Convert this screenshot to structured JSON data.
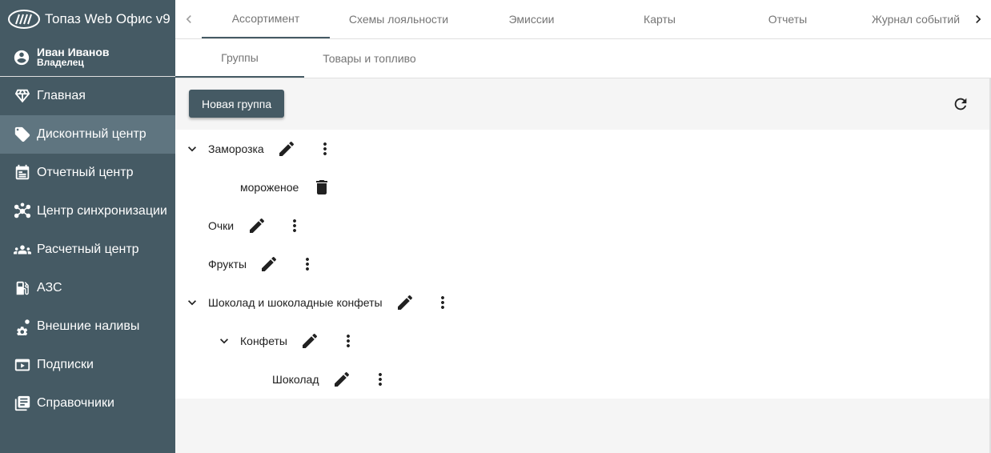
{
  "app": {
    "title": "Топаз Web Офис v9"
  },
  "user": {
    "name": "Иван Иванов",
    "role": "Владелец"
  },
  "sidebar": {
    "items": [
      {
        "label": "Главная",
        "icon": "diamond-icon",
        "active": false
      },
      {
        "label": "Дисконтный центр",
        "icon": "tag-icon",
        "active": true
      },
      {
        "label": "Отчетный центр",
        "icon": "report-icon",
        "active": false
      },
      {
        "label": "Центр синхронизации",
        "icon": "hub-icon",
        "active": false
      },
      {
        "label": "Расчетный центр",
        "icon": "people-icon",
        "active": false
      },
      {
        "label": "АЗС",
        "icon": "fuel-station-icon",
        "active": false
      },
      {
        "label": "Внешние наливы",
        "icon": "gear-icon",
        "active": false
      },
      {
        "label": "Подписки",
        "icon": "subscription-icon",
        "active": false
      },
      {
        "label": "Справочники",
        "icon": "library-icon",
        "active": false
      }
    ]
  },
  "tabs": [
    "Ассортимент",
    "Схемы лояльности",
    "Эмиссии",
    "Карты",
    "Отчеты",
    "Журнал событий"
  ],
  "active_tab": "Ассортимент",
  "subtabs": [
    "Группы",
    "Товары и топливо"
  ],
  "active_subtab": "Группы",
  "toolbar": {
    "new_group_label": "Новая группа"
  },
  "tree": [
    {
      "label": "Заморозка",
      "level": 0,
      "expanded": true,
      "actions": [
        "edit",
        "more"
      ]
    },
    {
      "label": "мороженое",
      "level": 1,
      "leaf": true,
      "actions": [
        "delete"
      ]
    },
    {
      "label": "Очки",
      "level": 0,
      "actions": [
        "edit",
        "more"
      ]
    },
    {
      "label": "Фрукты",
      "level": 0,
      "actions": [
        "edit",
        "more"
      ]
    },
    {
      "label": "Шоколад и шоколадные конфеты",
      "level": 0,
      "expanded": true,
      "actions": [
        "edit",
        "more"
      ]
    },
    {
      "label": "Конфеты",
      "level": 1,
      "expanded": true,
      "actions": [
        "edit",
        "more"
      ]
    },
    {
      "label": "Шоколад",
      "level": 2,
      "actions": [
        "edit",
        "more"
      ]
    }
  ],
  "colors": {
    "sidebar": "#455a64",
    "sidebar_active": "#5f7580",
    "accent": "#455a64"
  }
}
